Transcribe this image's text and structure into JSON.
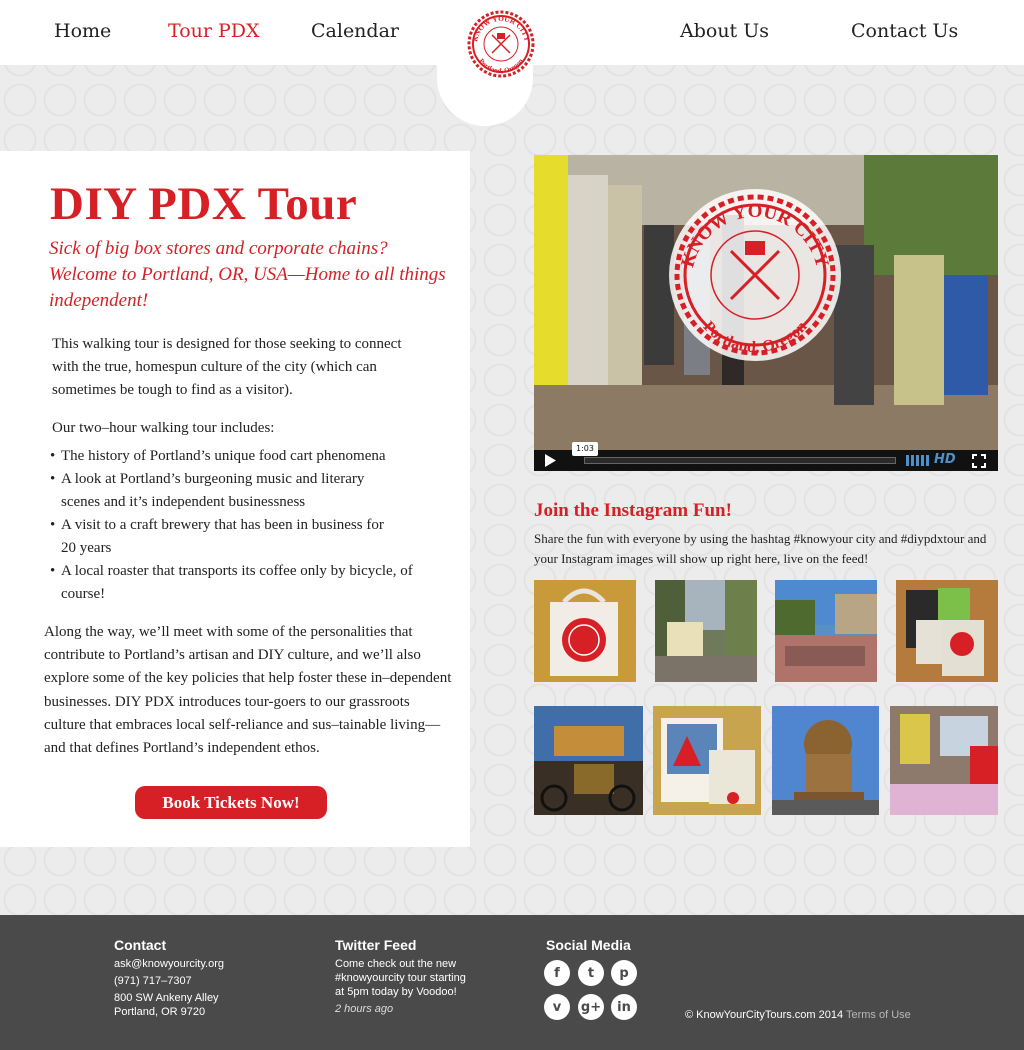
{
  "colors": {
    "brand_red": "#d71f26",
    "footer_bg": "#4a4a4a",
    "page_bg": "#ececec",
    "video_hd": "#4f90c8"
  },
  "nav": {
    "items": [
      {
        "label": "Home",
        "active": false
      },
      {
        "label": "Tour PDX",
        "active": true
      },
      {
        "label": "Calendar",
        "active": false
      },
      {
        "label": "About Us",
        "active": false
      },
      {
        "label": "Contact Us",
        "active": false
      }
    ],
    "logo": {
      "top_text": "KNOW YOUR CITY",
      "bottom_text": "Portland, Oregon"
    }
  },
  "main": {
    "title": "DIY PDX Tour",
    "subtitle": "Sick of big box stores and corporate chains? Welcome to Portland, OR, USA—Home to all things independent!",
    "intro": "This walking tour is designed for those seeking to connect with the true, homespun culture of the city (which can sometimes be tough to find as a visitor).",
    "includes_label": "Our two–hour walking tour includes:",
    "bullets": [
      "The history of Portland’s unique food cart phenomena",
      "A look at Portland’s burgeoning music and literary scenes and it’s independent businessness",
      "A visit to a craft brewery that has been in business for 20 years",
      "A local roaster that transports its coffee only by bicycle, of course!"
    ],
    "closing": "Along the way, we’ll meet with some of the personalities that contribute to Portland’s artisan and DIY culture, and we’ll also explore some of the key policies that help foster these in–dependent businesses. DIY PDX introduces tour-goers to our grassroots culture that embraces local self-reliance and sus–tainable living—and that defines Portland’s independent ethos.",
    "book_button": "Book Tickets Now!"
  },
  "video": {
    "time": "1:03",
    "hd_label": "HD",
    "play_icon": "play-icon",
    "fullscreen_icon": "fullscreen-icon",
    "progress": 0.0
  },
  "instagram": {
    "title": "Join the Instagram Fun!",
    "description": "Share the fun with everyone by using the hashtag #knowyour city and #diypdxtour and your Instagram images will show up right here, live on the feed!"
  },
  "footer": {
    "contact": {
      "heading": "Contact",
      "email": "ask@knowyourcity.org",
      "phone": "(971) 717–7307",
      "address1": "800 SW Ankeny Alley",
      "address2": "Portland, OR 9720"
    },
    "twitter": {
      "heading": "Twitter Feed",
      "line1": "Come check out the new",
      "line2": "#knowyourcity tour starting",
      "line3": "at 5pm today by Voodoo!",
      "time": "2 hours ago"
    },
    "social": {
      "heading": "Social Media",
      "icons": [
        {
          "name": "facebook-icon",
          "glyph": "f"
        },
        {
          "name": "twitter-icon",
          "glyph": "t"
        },
        {
          "name": "pinterest-icon",
          "glyph": "p"
        },
        {
          "name": "vimeo-icon",
          "glyph": "v"
        },
        {
          "name": "googleplus-icon",
          "glyph": "g+"
        },
        {
          "name": "linkedin-icon",
          "glyph": "in"
        }
      ]
    },
    "copyright": "© KnowYourCityTours.com 2014",
    "terms": "Terms of Use"
  }
}
